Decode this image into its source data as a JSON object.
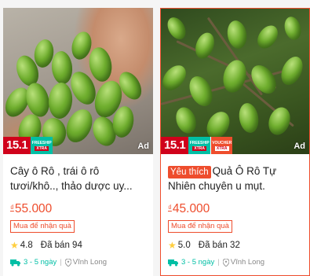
{
  "products": [
    {
      "title": "Cây ô Rô , trái ô rô tươi/khô.., thảo dược uy...",
      "favorite_tag": "",
      "price_currency": "₫",
      "price": "55.000",
      "promo": "Mua để nhận quà",
      "rating": "4.8",
      "sold": "Đã bán 94",
      "shipping_days": "3 - 5 ngày",
      "location": "Vĩnh Long",
      "badge_sale": "15.1",
      "badge_freeship_top": "FREESHIP",
      "badge_freeship_bottom": "XTRA",
      "ad": "Ad"
    },
    {
      "title": "Quả Ô Rô Tự Nhiên chuyên u mụt.",
      "favorite_tag": "Yêu thích",
      "price_currency": "₫",
      "price": "45.000",
      "promo": "Mua để nhận quà",
      "rating": "5.0",
      "sold": "Đã bán 32",
      "shipping_days": "3 - 5 ngày",
      "location": "Vĩnh Long",
      "badge_sale": "15.1",
      "badge_freeship_top": "FREESHIP",
      "badge_freeship_bottom": "XTRA",
      "badge_voucher_top": "VOUCHER",
      "badge_voucher_bottom": "XTRA",
      "ad": "Ad"
    }
  ],
  "colors": {
    "accent": "#ee4d2d",
    "teal": "#00bfa5",
    "star": "#ffce3d"
  },
  "icons": [
    "star-icon",
    "truck-icon",
    "location-pin-icon"
  ]
}
